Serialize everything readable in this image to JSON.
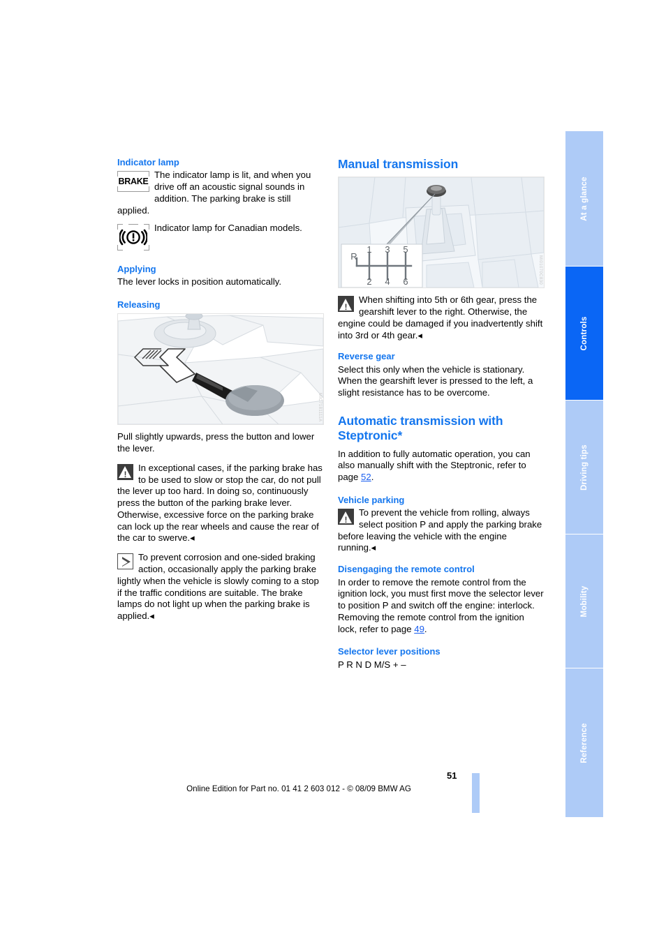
{
  "document": {
    "page_number": "51",
    "footer": "Online Edition for Part no. 01 41 2 603 012 - © 08/09 BMW AG"
  },
  "sidebar": {
    "tabs": [
      {
        "label": "At a glance",
        "active": false
      },
      {
        "label": "Controls",
        "active": true
      },
      {
        "label": "Driving tips",
        "active": false
      },
      {
        "label": "Mobility",
        "active": false
      },
      {
        "label": "Reference",
        "active": false
      }
    ],
    "colors": {
      "active": "#0a66f5",
      "inactive": "#aecbf7",
      "text": "#ffffff"
    }
  },
  "left_column": {
    "indicator_lamp": {
      "heading": "Indicator lamp",
      "brake_icon_label": "BRAKE",
      "brake_note": "The indicator lamp is lit, and when you drive off an acoustic signal sounds in addition. The parking brake is still applied.",
      "canadian_note": "Indicator lamp for Canadian models."
    },
    "applying": {
      "heading": "Applying",
      "text": "The lever locks in position automatically."
    },
    "releasing": {
      "heading": "Releasing",
      "figure_caption_code": "",
      "instruction": "Pull slightly upwards, press the button and lower the lever.",
      "warning": "In exceptional cases, if the parking brake has to be used to slow or stop the car, do not pull the lever up too hard. In doing so, continuously press the button of the parking brake lever.",
      "warning_cont": "Otherwise, excessive force on the parking brake can lock up the rear wheels and cause the rear of the car to swerve.",
      "tip": "To prevent corrosion and one-sided braking action, occasionally apply the parking brake lightly when the vehicle is slowly coming to a stop if the traffic conditions are suitable. The brake lamps do not light up when the parking brake is applied."
    }
  },
  "right_column": {
    "manual_transmission": {
      "heading": "Manual transmission",
      "gear_pattern": {
        "reverse_label": "R",
        "top_row": [
          "1",
          "3",
          "5"
        ],
        "bottom_row": [
          "2",
          "4",
          "6"
        ]
      },
      "warning": "When shifting into 5th or 6th gear, press the gearshift lever to the right. Otherwise, the engine could be damaged if you inadvertently shift into 3rd or 4th gear.",
      "reverse_gear": {
        "heading": "Reverse gear",
        "text": "Select this only when the vehicle is stationary. When the gearshift lever is pressed to the left, a slight resistance has to be overcome."
      }
    },
    "automatic_transmission": {
      "heading": "Automatic transmission with Steptronic*",
      "intro_before": "In addition to fully automatic operation, you can also manually shift with the Steptronic, refer to page ",
      "intro_link": "52",
      "intro_after": ".",
      "vehicle_parking": {
        "heading": "Vehicle parking",
        "warning": "To prevent the vehicle from rolling, always select position P and apply the parking brake before leaving the vehicle with the engine running."
      },
      "disengaging": {
        "heading": "Disengaging the remote control",
        "text_before": "In order to remove the remote control from the ignition lock, you must first move the selector lever to position P and switch off the engine: interlock. Removing the remote control from the ignition lock, refer to page ",
        "link": "49",
        "text_after": "."
      },
      "selector_positions": {
        "heading": "Selector lever positions",
        "text": "P R N D M/S + –"
      }
    }
  },
  "colors": {
    "heading_blue": "#1476ee",
    "link_blue": "#1a5ff0",
    "body_text": "#000000"
  }
}
